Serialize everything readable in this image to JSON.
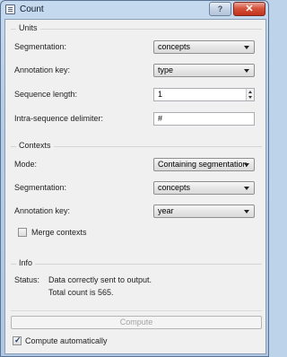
{
  "window": {
    "title": "Count",
    "help_label": "?",
    "close_label": "✕"
  },
  "units": {
    "title": "Units",
    "segmentation_label": "Segmentation:",
    "segmentation_value": "concepts",
    "annotation_key_label": "Annotation key:",
    "annotation_key_value": "type",
    "sequence_length_label": "Sequence length:",
    "sequence_length_value": "1",
    "delimiter_label": "Intra-sequence delimiter:",
    "delimiter_value": "#"
  },
  "contexts": {
    "title": "Contexts",
    "mode_label": "Mode:",
    "mode_value": "Containing segmentation",
    "segmentation_label": "Segmentation:",
    "segmentation_value": "concepts",
    "annotation_key_label": "Annotation key:",
    "annotation_key_value": "year",
    "merge_label": "Merge contexts",
    "merge_checked": false
  },
  "info": {
    "title": "Info",
    "status_label": "Status:",
    "status_line1": "Data correctly sent to output.",
    "status_line2": "Total count is 565."
  },
  "footer": {
    "compute_label": "Compute",
    "auto_label": "Compute automatically",
    "auto_checked": true,
    "check_glyph": "✓"
  }
}
